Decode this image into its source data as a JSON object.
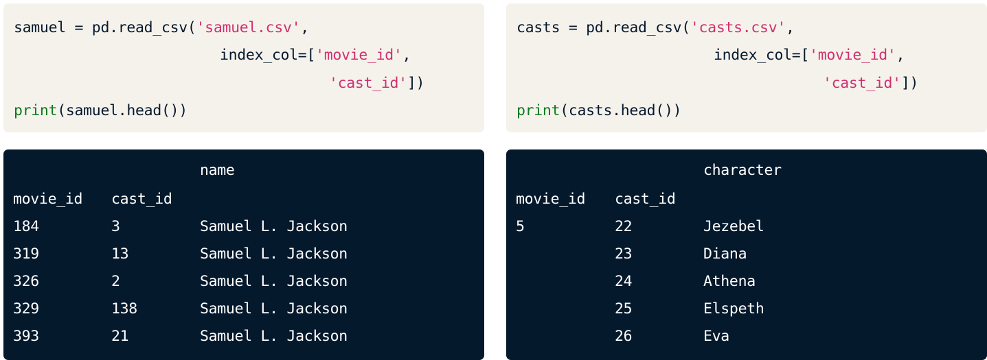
{
  "left": {
    "code": {
      "l1_prefix": "samuel = pd.read_csv(",
      "l1_string": "'samuel.csv'",
      "l1_suffix": ",",
      "l2_prefix": "index_col=[",
      "l2_string": "'movie_id'",
      "l2_suffix": ",",
      "l3_string": "'cast_id'",
      "l3_suffix": "])",
      "l4_fn": "print",
      "l4_rest": "(samuel.head())"
    },
    "output": {
      "column_header": "name",
      "index_headers": [
        "movie_id",
        "cast_id"
      ],
      "rows": [
        {
          "movie_id": "184",
          "cast_id": "3",
          "value": "Samuel L. Jackson"
        },
        {
          "movie_id": "319",
          "cast_id": "13",
          "value": "Samuel L. Jackson"
        },
        {
          "movie_id": "326",
          "cast_id": "2",
          "value": "Samuel L. Jackson"
        },
        {
          "movie_id": "329",
          "cast_id": "138",
          "value": "Samuel L. Jackson"
        },
        {
          "movie_id": "393",
          "cast_id": "21",
          "value": "Samuel L. Jackson"
        }
      ]
    }
  },
  "right": {
    "code": {
      "l1_prefix": "casts = pd.read_csv(",
      "l1_string": "'casts.csv'",
      "l1_suffix": ",",
      "l2_prefix": "index_col=[",
      "l2_string": "'movie_id'",
      "l2_suffix": ",",
      "l3_string": "'cast_id'",
      "l3_suffix": "])",
      "l4_fn": "print",
      "l4_rest": "(casts.head())"
    },
    "output": {
      "column_header": "character",
      "index_headers": [
        "movie_id",
        "cast_id"
      ],
      "rows": [
        {
          "movie_id": "5",
          "cast_id": "22",
          "value": "Jezebel"
        },
        {
          "movie_id": "",
          "cast_id": "23",
          "value": "Diana"
        },
        {
          "movie_id": "",
          "cast_id": "24",
          "value": "Athena"
        },
        {
          "movie_id": "",
          "cast_id": "25",
          "value": "Elspeth"
        },
        {
          "movie_id": "",
          "cast_id": "26",
          "value": "Eva"
        }
      ]
    }
  },
  "colors": {
    "code_bg": "#f5f2ec",
    "output_bg": "#05192d",
    "string": "#d0306f",
    "function": "#0b7a1d"
  }
}
